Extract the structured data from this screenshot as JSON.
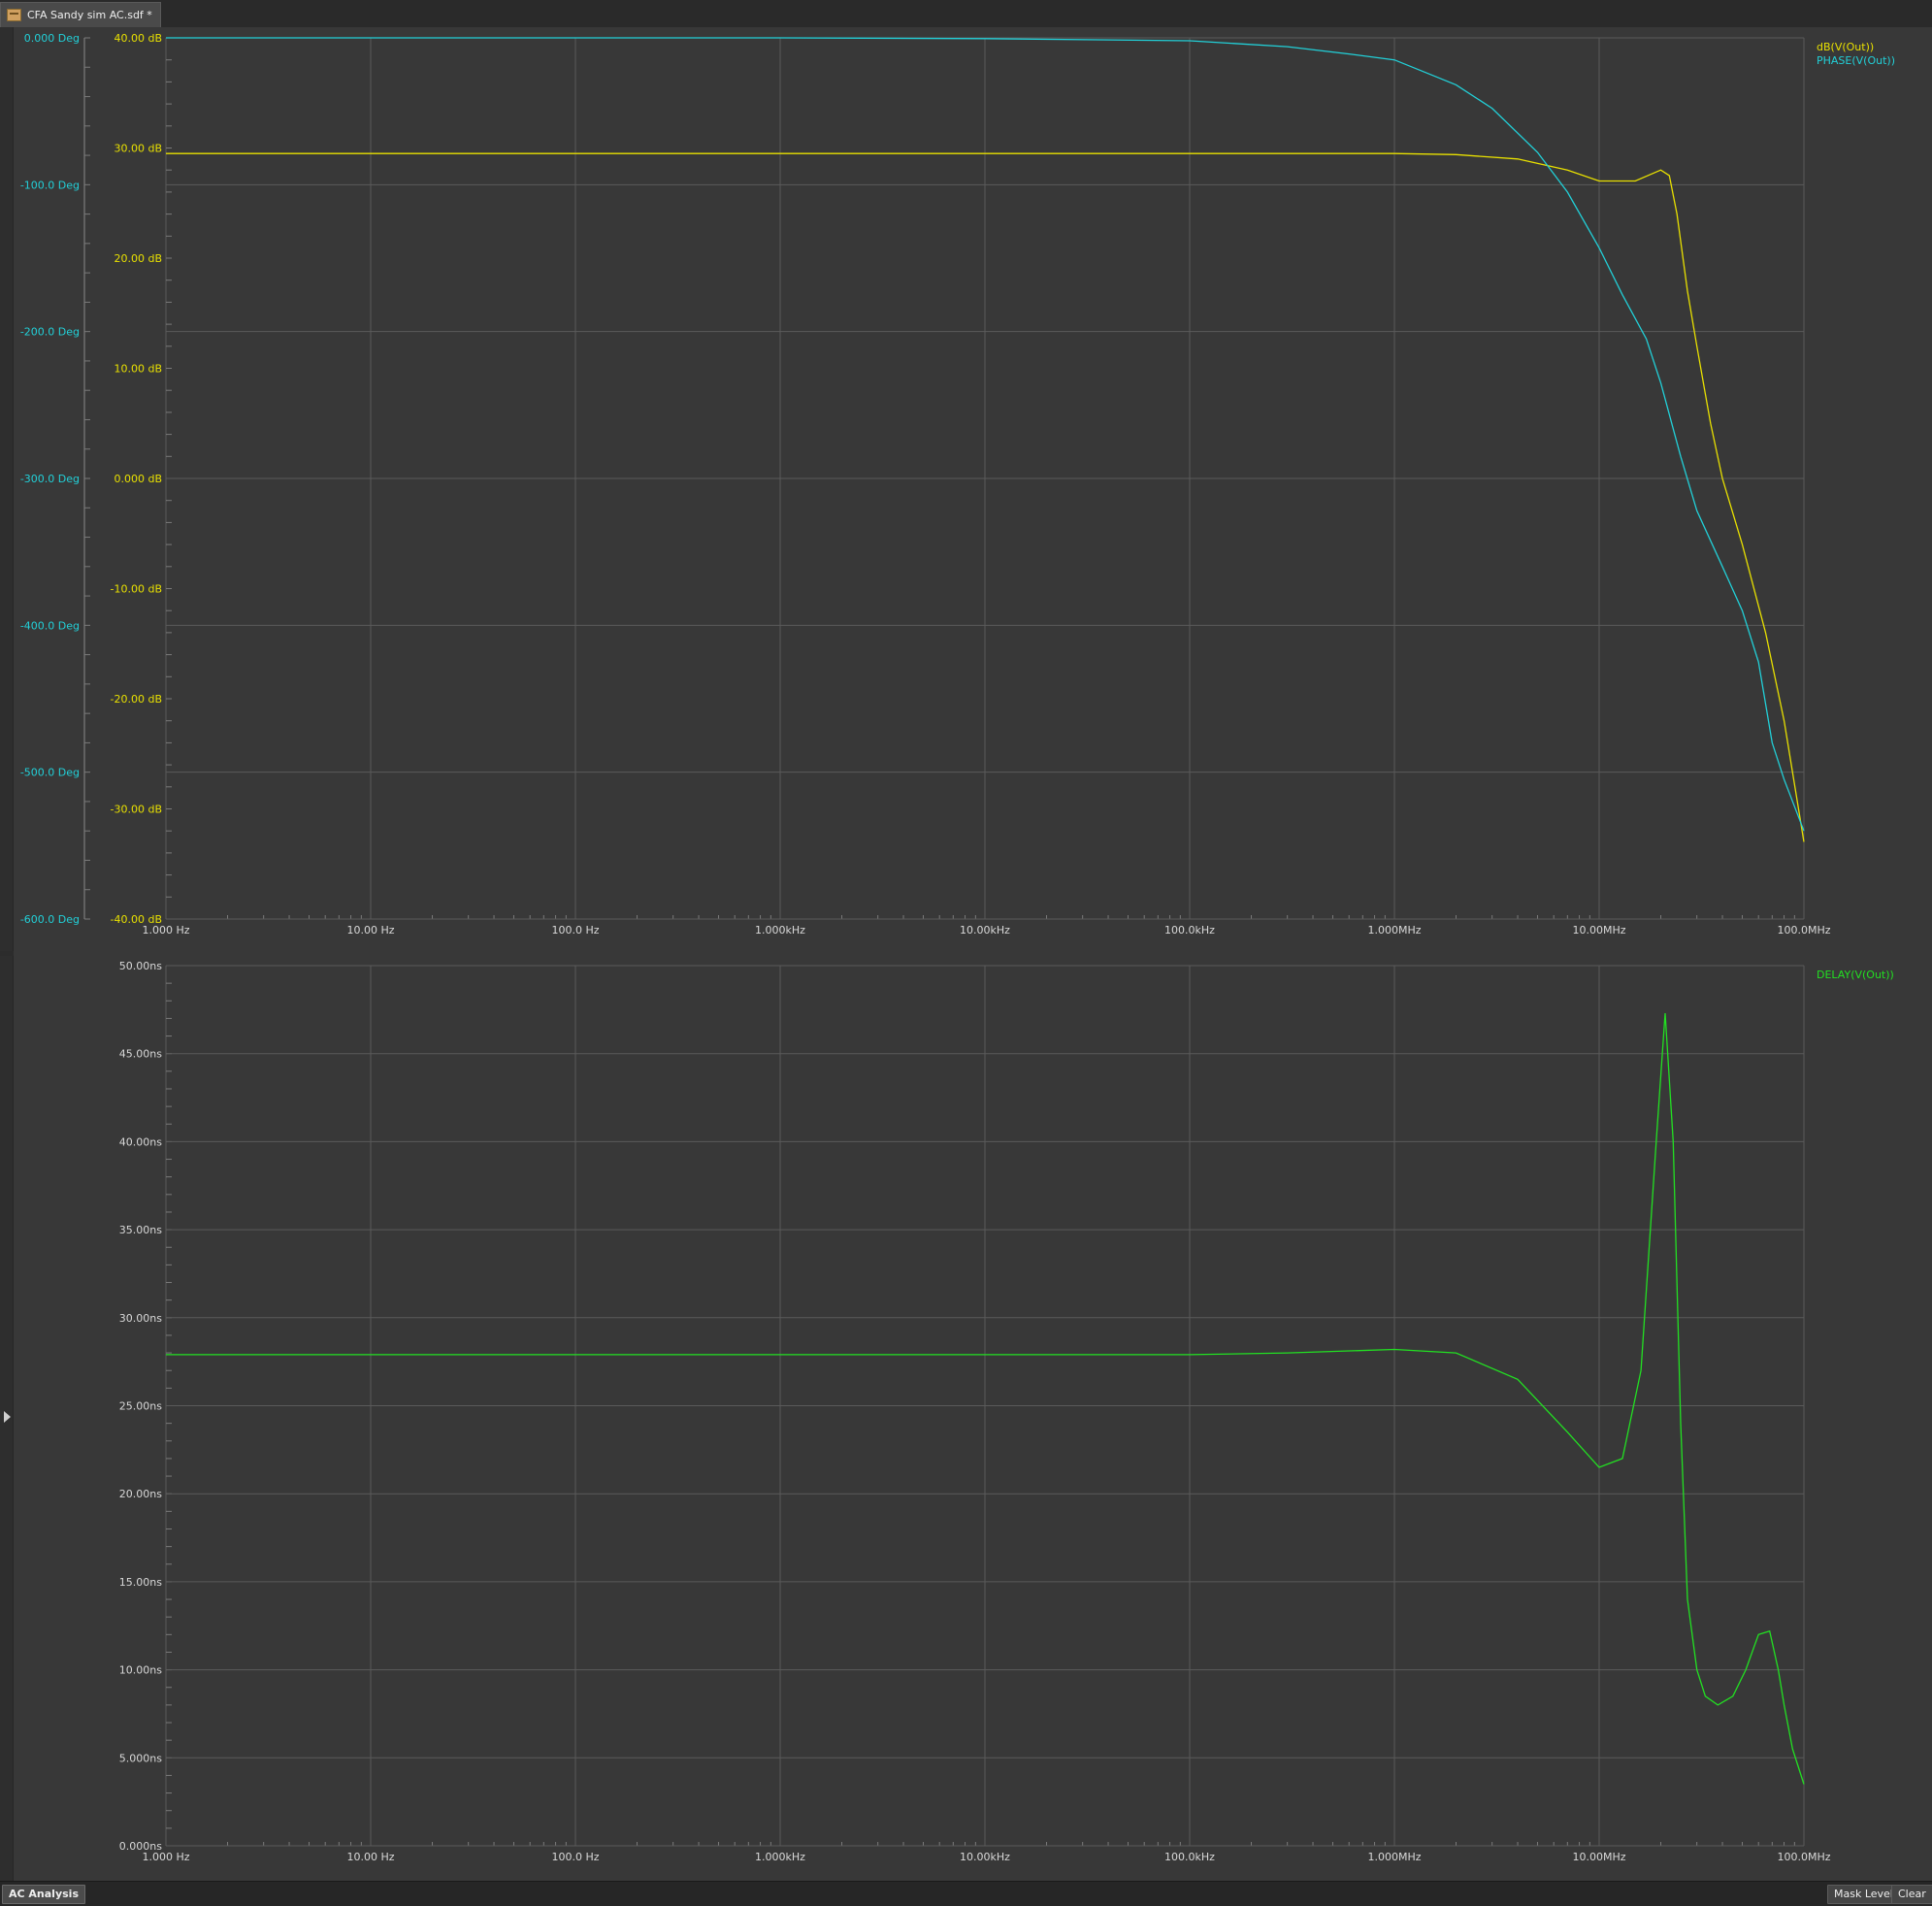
{
  "document_tab": {
    "title": "CFA Sandy sim AC.sdf *",
    "icon": "schematic-doc-icon"
  },
  "bottom_bar": {
    "analysis_tab": "AC Analysis",
    "mask_level_button": "Mask Level",
    "clear_button": "Clear"
  },
  "colors": {
    "db": "#e8e000",
    "phase": "#22d0d8",
    "delay": "#22e022",
    "grid": "#5a5a5a",
    "background": "#383838"
  },
  "chart_data": [
    {
      "type": "line",
      "xscale": "log",
      "xlim": [
        1,
        100000000
      ],
      "x_ticks": [
        1,
        10,
        100,
        1000,
        10000,
        100000,
        1000000,
        10000000,
        100000000
      ],
      "x_tick_labels": [
        "1.000 Hz",
        "10.00 Hz",
        "100.0 Hz",
        "1.000kHz",
        "10.00kHz",
        "100.0kHz",
        "1.000MHz",
        "10.00MHz",
        "100.0MHz"
      ],
      "axes": {
        "left_outer": {
          "series": "PHASE(V(Out))",
          "ylim": [
            -600,
            0
          ],
          "ticks": [
            0,
            -100,
            -200,
            -300,
            -400,
            -500,
            -600
          ],
          "tick_labels": [
            "0.000 Deg",
            "-100.0 Deg",
            "-200.0 Deg",
            "-300.0 Deg",
            "-400.0 Deg",
            "-500.0 Deg",
            "-600.0 Deg"
          ]
        },
        "left_inner": {
          "series": "dB(V(Out))",
          "ylim": [
            -40,
            40
          ],
          "ticks": [
            40,
            30,
            20,
            10,
            0,
            -10,
            -20,
            -30,
            -40
          ],
          "tick_labels": [
            "40.00 dB",
            "30.00 dB",
            "20.00 dB",
            "10.00 dB",
            "0.000 dB",
            "-10.00 dB",
            "-20.00 dB",
            "-30.00 dB",
            "-40.00 dB"
          ]
        }
      },
      "legend": "top-right",
      "grid": true,
      "series": [
        {
          "name": "dB(V(Out))",
          "axis": "left_inner",
          "color": "#e8e000",
          "x": [
            1,
            10,
            100,
            1000,
            10000,
            100000,
            1000000,
            2000000,
            4000000,
            7000000,
            10000000,
            15000000,
            20000000,
            22000000,
            24000000,
            27000000,
            30000000,
            35000000,
            40000000,
            50000000,
            65000000,
            80000000,
            100000000
          ],
          "y": [
            29.5,
            29.5,
            29.5,
            29.5,
            29.5,
            29.5,
            29.5,
            29.4,
            29.0,
            28.0,
            27.0,
            27.0,
            28.0,
            27.5,
            24.0,
            17.0,
            12.0,
            5.0,
            0.0,
            -6.0,
            -14.0,
            -22.0,
            -33.0
          ]
        },
        {
          "name": "PHASE(V(Out))",
          "axis": "left_outer",
          "color": "#22d0d8",
          "x": [
            1,
            10,
            100,
            1000,
            10000,
            100000,
            300000,
            600000,
            1000000,
            2000000,
            3000000,
            5000000,
            7000000,
            10000000,
            13000000,
            17000000,
            20000000,
            25000000,
            30000000,
            40000000,
            50000000,
            60000000,
            70000000,
            80000000,
            100000000
          ],
          "y": [
            0,
            0,
            0,
            0,
            -0.5,
            -2,
            -6,
            -11,
            -15,
            -32,
            -48,
            -78,
            -105,
            -143,
            -175,
            -205,
            -235,
            -285,
            -322,
            -360,
            -390,
            -425,
            -480,
            -505,
            -540
          ]
        }
      ]
    },
    {
      "type": "line",
      "xscale": "log",
      "xlim": [
        1,
        100000000
      ],
      "x_ticks": [
        1,
        10,
        100,
        1000,
        10000,
        100000,
        1000000,
        10000000,
        100000000
      ],
      "x_tick_labels": [
        "1.000 Hz",
        "10.00 Hz",
        "100.0 Hz",
        "1.000kHz",
        "10.00kHz",
        "100.0kHz",
        "1.000MHz",
        "10.00MHz",
        "100.0MHz"
      ],
      "ylim": [
        0,
        50
      ],
      "y_ticks": [
        50,
        45,
        40,
        35,
        30,
        25,
        20,
        15,
        10,
        5,
        0
      ],
      "y_tick_labels": [
        "50.00ns",
        "45.00ns",
        "40.00ns",
        "35.00ns",
        "30.00ns",
        "25.00ns",
        "20.00ns",
        "15.00ns",
        "10.00ns",
        "5.000ns",
        "0.000ns"
      ],
      "legend": "top-right",
      "grid": true,
      "series": [
        {
          "name": "DELAY(V(Out))",
          "color": "#22e022",
          "x": [
            1,
            10,
            100,
            1000,
            10000,
            100000,
            300000,
            1000000,
            2000000,
            4000000,
            7000000,
            10000000,
            13000000,
            16000000,
            19000000,
            21000000,
            23000000,
            25000000,
            27000000,
            30000000,
            33000000,
            38000000,
            45000000,
            52000000,
            60000000,
            68000000,
            75000000,
            80000000,
            88000000,
            100000000
          ],
          "y": [
            27.9,
            27.9,
            27.9,
            27.9,
            27.9,
            27.9,
            28.0,
            28.2,
            28.0,
            26.5,
            23.5,
            21.5,
            22.0,
            27.0,
            40.0,
            47.3,
            40.0,
            24.0,
            14.0,
            10.0,
            8.5,
            8.0,
            8.5,
            10.0,
            12.0,
            12.2,
            10.0,
            8.0,
            5.5,
            3.5
          ]
        }
      ]
    }
  ]
}
